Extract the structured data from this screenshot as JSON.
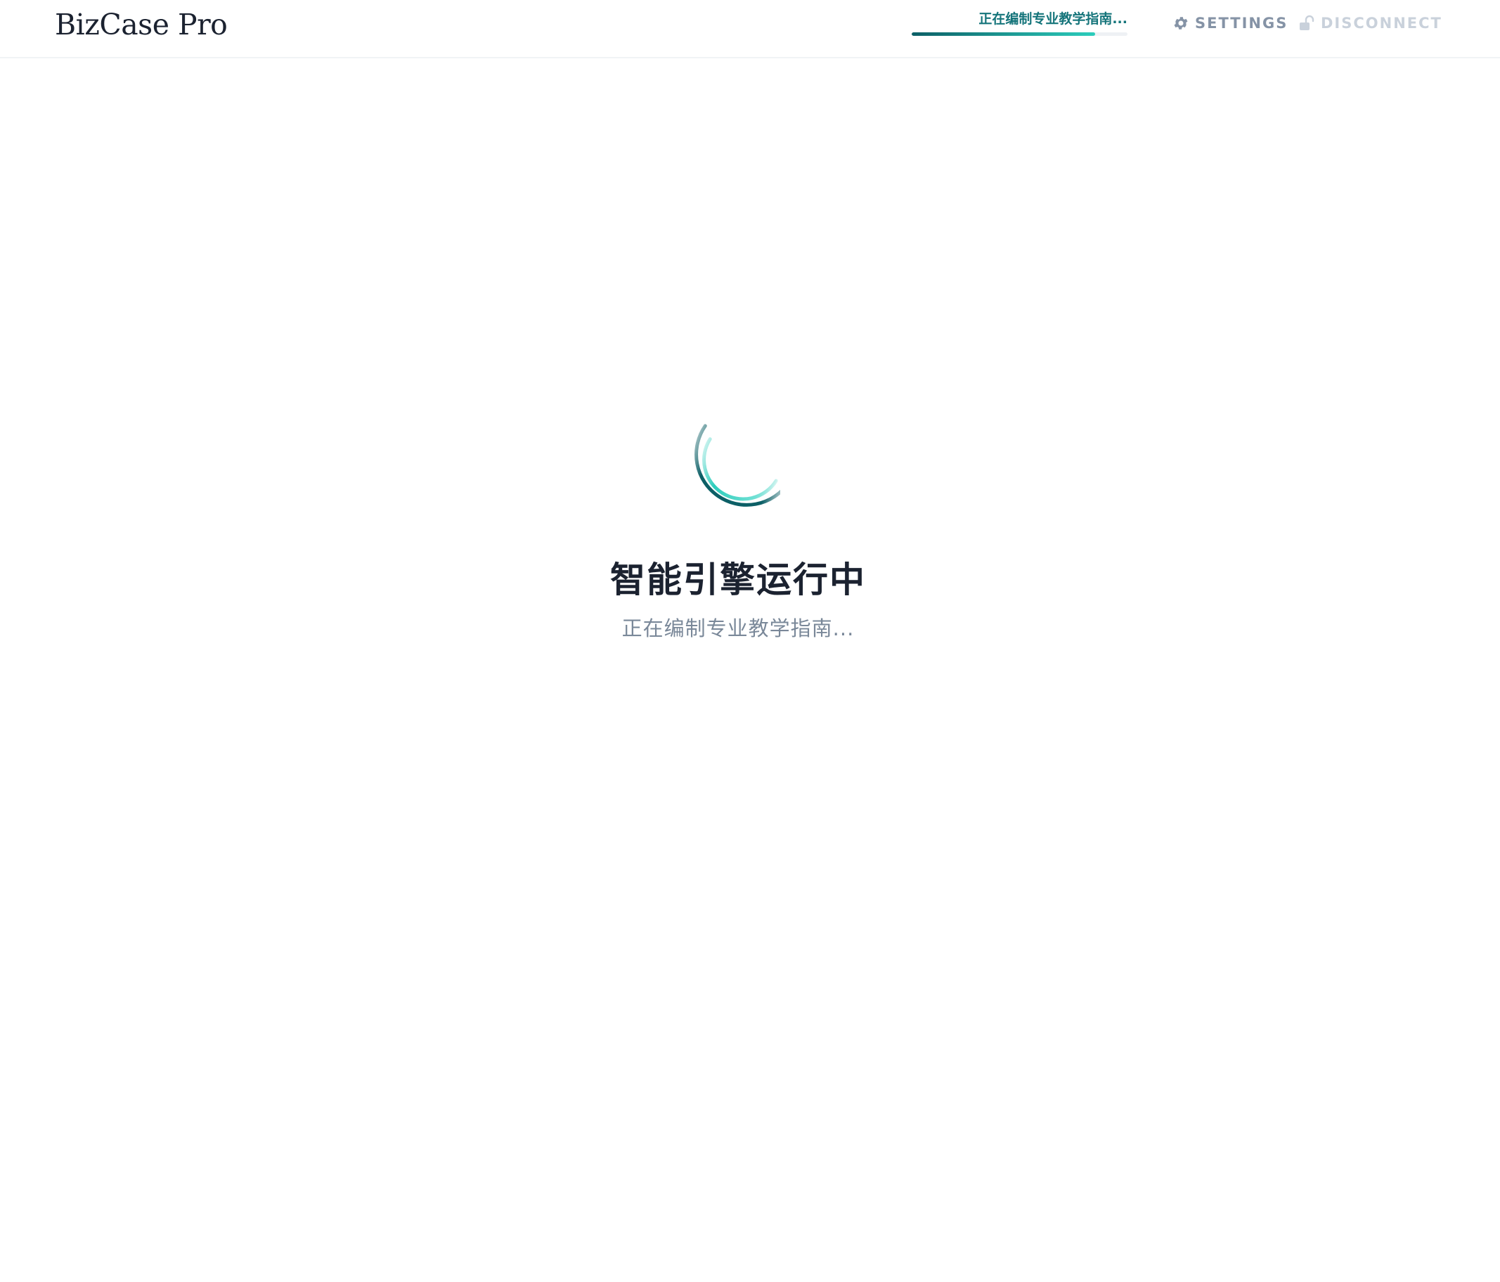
{
  "header": {
    "logo": "BizCase Pro",
    "progress": {
      "label": "正在编制专业教学指南...",
      "percent": 85
    },
    "settings_label": "SETTINGS",
    "disconnect_label": "DISCONNECT"
  },
  "main": {
    "title": "智能引擎运行中",
    "subtitle": "正在编制专业教学指南..."
  },
  "colors": {
    "accent_dark": "#0c5f66",
    "accent_light": "#2ccdbc",
    "text_dark": "#1b2230",
    "text_muted": "#7a8899"
  },
  "icons": {
    "settings": "gear-icon",
    "disconnect": "unlock-icon",
    "loader": "spinner-icon"
  }
}
